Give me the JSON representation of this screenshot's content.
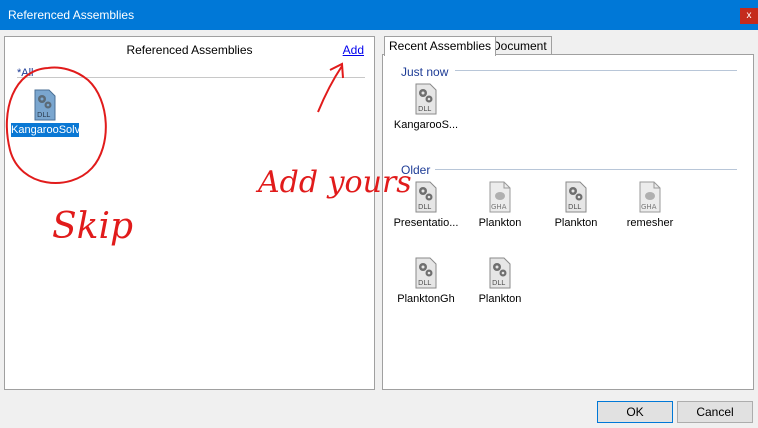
{
  "window": {
    "title": "Referenced Assemblies",
    "close_glyph": "x"
  },
  "left": {
    "header": "Referenced Assemblies",
    "add_link": "Add",
    "group": "*All",
    "assemblies": [
      {
        "label": "KangarooSolver",
        "icon": "dll-gear-icon",
        "selected": true
      }
    ]
  },
  "tabs": [
    {
      "label": "Recent Assemblies",
      "active": true
    },
    {
      "label": "Document",
      "active": false
    }
  ],
  "groups": [
    {
      "title": "Just now",
      "items": [
        {
          "label": "KangarooS...",
          "icon": "dll-gear-icon"
        }
      ]
    },
    {
      "title": "Older",
      "items": [
        {
          "label": "Presentatio...",
          "icon": "dll-gear-icon"
        },
        {
          "label": "Plankton",
          "icon": "gha-icon"
        },
        {
          "label": "Plankton",
          "icon": "dll-gear-icon"
        },
        {
          "label": "remesher",
          "icon": "gha-icon"
        },
        {
          "label": "PlanktonGh",
          "icon": "dll-gear-icon"
        },
        {
          "label": "Plankton",
          "icon": "dll-gear-icon"
        }
      ]
    }
  ],
  "buttons": {
    "ok": "OK",
    "cancel": "Cancel"
  },
  "annotations": {
    "skip": "Skip",
    "add_yours": "Add yours",
    "color": "#e11b1b"
  },
  "icon_labels": {
    "dll": "DLL",
    "gha": "GHA"
  }
}
